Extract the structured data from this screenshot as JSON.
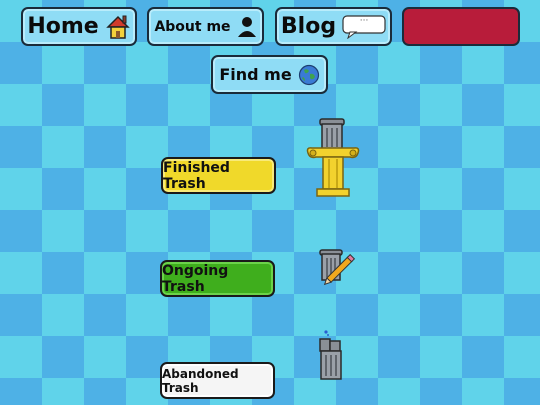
{
  "nav": {
    "home_label": "Home",
    "about_label": "About me",
    "blog_label": "Blog",
    "blog_bubble": "···",
    "find_label": "Find me"
  },
  "trash": {
    "finished_label": "Finished Trash",
    "ongoing_label": "Ongoing Trash",
    "abandoned_label": "Abandoned Trash"
  },
  "colors": {
    "accent_red": "#b81c3a",
    "finished": "#f0d92a",
    "ongoing": "#3fae1d",
    "abandoned": "#f5f5f5"
  }
}
